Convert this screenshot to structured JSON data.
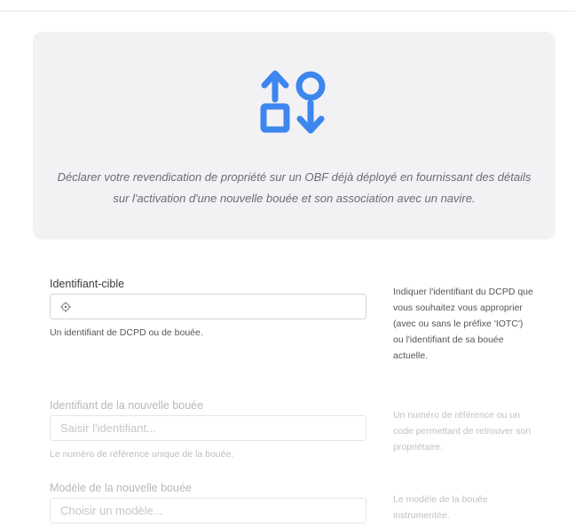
{
  "hero": {
    "icon_name": "shapes-exchange-icon",
    "accent_color": "#3d86ee",
    "description": "Déclarer votre revendication de propriété sur un OBF déjà déployé en fournissant des détails sur l'activation d'une nouvelle bouée et son association avec un navire."
  },
  "fields": {
    "target_id": {
      "label": "Identifiant-cible",
      "value": "",
      "icon": "crosshair-icon",
      "hint": "Un identifiant de DCPD ou de bouée.",
      "help": "Indiquer l'identifiant du DCPD que vous souhaitez vous approprier (avec ou sans le préfixe 'IOTC') ou l'identifiant de sa bouée actuelle."
    },
    "new_buoy_id": {
      "label": "Identifiant de la nouvelle bouée",
      "placeholder": "Saisir l'identifiant...",
      "hint": "Le numéro de référence unique de la bouée.",
      "help": "Un numéro de référence ou un code permettant de retrouver son propriétaire."
    },
    "new_buoy_model": {
      "label": "Modèle de la nouvelle bouée",
      "placeholder": "Choisir un modèle...",
      "help": "Le modèle de la bouée instrumentée."
    }
  }
}
